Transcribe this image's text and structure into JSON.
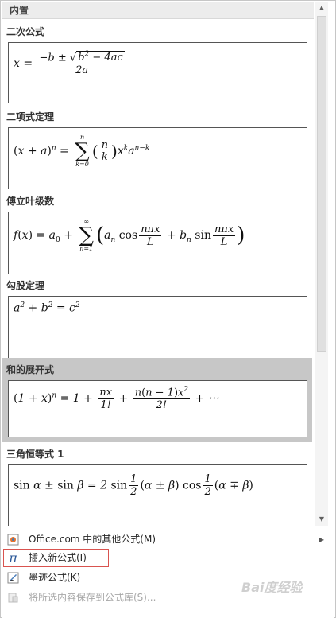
{
  "gallery": {
    "section_title": "内置",
    "items": [
      {
        "title": "二次公式",
        "formula": "x = (−b ± √(b² − 4ac)) / 2a"
      },
      {
        "title": "二项式定理",
        "formula": "(x + a)^n = Σ_{k=0}^{n} C(n,k) x^k a^{n−k}"
      },
      {
        "title": "傅立叶级数",
        "formula": "f(x) = a_0 + Σ_{n=1}^{∞} (a_n cos nπx/L + b_n sin nπx/L)"
      },
      {
        "title": "勾股定理",
        "formula": "a² + b² = c²"
      },
      {
        "title": "和的展开式",
        "formula": "(1 + x)^n = 1 + nx/1! + n(n−1)x²/2! + ⋯"
      },
      {
        "title": "三角恒等式 1",
        "formula": "sin α ± sin β = 2 sin ½(α ± β) cos ½(α ∓ β)"
      }
    ]
  },
  "menu": {
    "office": "Office.com 中的其他公式(M)",
    "insert": "插入新公式(I)",
    "ink": "墨迹公式(K)",
    "save": "将所选内容保存到公式库(S)..."
  },
  "watermark": "Bai度经验",
  "colors": {
    "hover": "#c7c7c7",
    "focus_border": "#d9534f",
    "disabled": "#a8a8a8"
  }
}
